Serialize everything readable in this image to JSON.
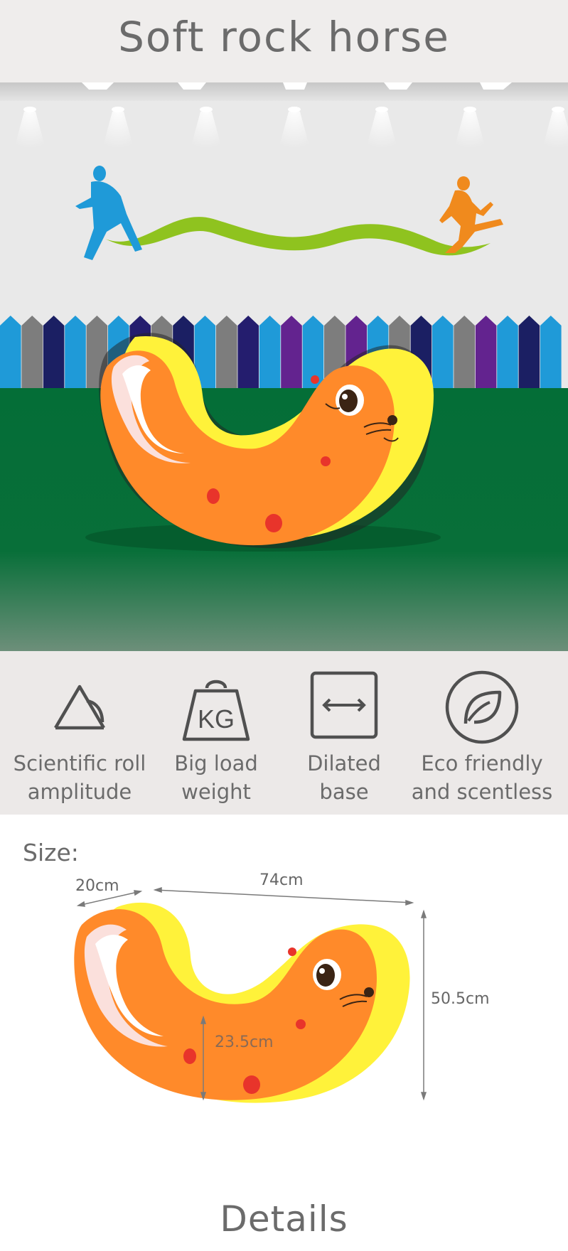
{
  "page": {
    "title": "Soft rock horse"
  },
  "features": [
    {
      "icon": "triangle-arc-icon",
      "label": "Scientific roll\namplitude"
    },
    {
      "icon": "kg-weight-icon",
      "label": "Big load\nweight"
    },
    {
      "icon": "expand-arrows-icon",
      "label": "Dilated\nbase"
    },
    {
      "icon": "leaf-icon",
      "label": "Eco friendly\nand scentless"
    }
  ],
  "size": {
    "heading": "Size:",
    "width_label": "20cm",
    "length_label": "74cm",
    "height_label": "50.5cm",
    "inner_height_label": "23.5cm"
  },
  "details": {
    "heading": "Details"
  },
  "colors": {
    "seal_orange": "#ff8a2a",
    "seal_yellow": "#fff23a",
    "grass": "#046e37",
    "wall": "#e8e8e8"
  }
}
